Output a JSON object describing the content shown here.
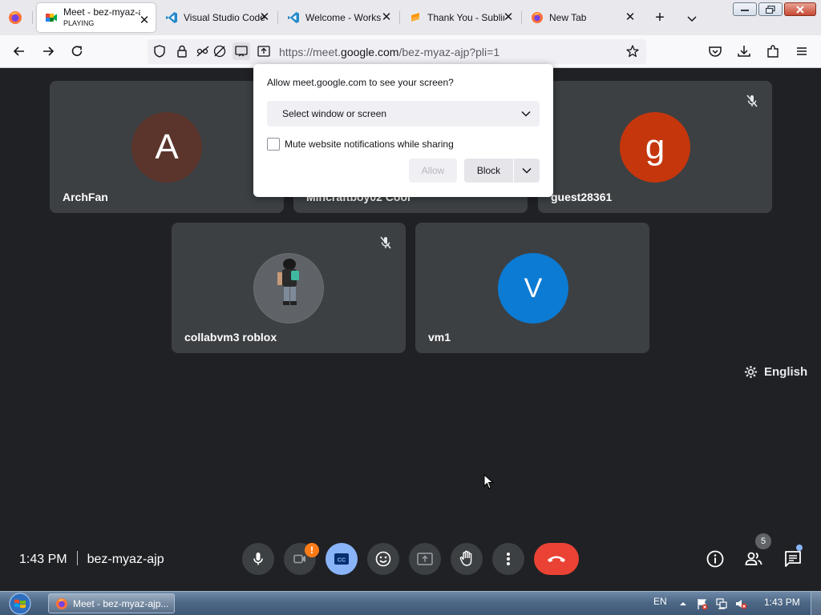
{
  "browser": {
    "tabs": [
      {
        "title": "Meet - bez-myaz-ajp",
        "subtitle": "PLAYING",
        "active": true,
        "favicon": "google-meet-icon"
      },
      {
        "title": "Visual Studio Code",
        "active": false,
        "favicon": "vscode-icon"
      },
      {
        "title": "Welcome - Workspace",
        "active": false,
        "favicon": "vscode-icon"
      },
      {
        "title": "Thank You - Sublime",
        "active": false,
        "favicon": "sublime-icon"
      },
      {
        "title": "New Tab",
        "active": false,
        "favicon": "firefox-icon"
      }
    ],
    "new_tab": "+",
    "url_prefix": "https://meet.",
    "url_domain": "google.com",
    "url_suffix": "/bez-myaz-ajp?pli=1"
  },
  "permission_popup": {
    "title": "Allow meet.google.com to see your screen?",
    "select_value": "Select window or screen",
    "checkbox_label": "Mute website notifications while sharing",
    "checkbox_checked": false,
    "allow_label": "Allow",
    "block_label": "Block"
  },
  "participants": [
    {
      "name": "ArchFan",
      "initial": "A",
      "color": "#5b352c",
      "muted": false
    },
    {
      "name": "Mincraftboy02 Cool",
      "initial": "",
      "color": "#3c4043",
      "muted": false
    },
    {
      "name": "guest28361",
      "initial": "g",
      "color": "#c5360d",
      "muted": true
    },
    {
      "name": "collabvm3 roblox",
      "initial": "",
      "color": "#5f6368",
      "muted": true,
      "avatar": "roblox-character-avatar"
    },
    {
      "name": "vm1",
      "initial": "V",
      "color": "#0b7bd4",
      "muted": false
    }
  ],
  "language_label": "English",
  "meeting": {
    "time": "1:43 PM",
    "code": "bez-myaz-ajp",
    "camera_warning": "!",
    "people_count": "5"
  },
  "taskbar": {
    "task_label": "Meet - bez-myaz-ajp...",
    "lang": "EN",
    "clock": "1:43 PM"
  },
  "colors": {
    "meet_bg": "#202124",
    "tile_bg": "#3c4043",
    "cc_active": "#8ab4f8",
    "end_call": "#ea4335",
    "warning": "#fa7b17"
  }
}
